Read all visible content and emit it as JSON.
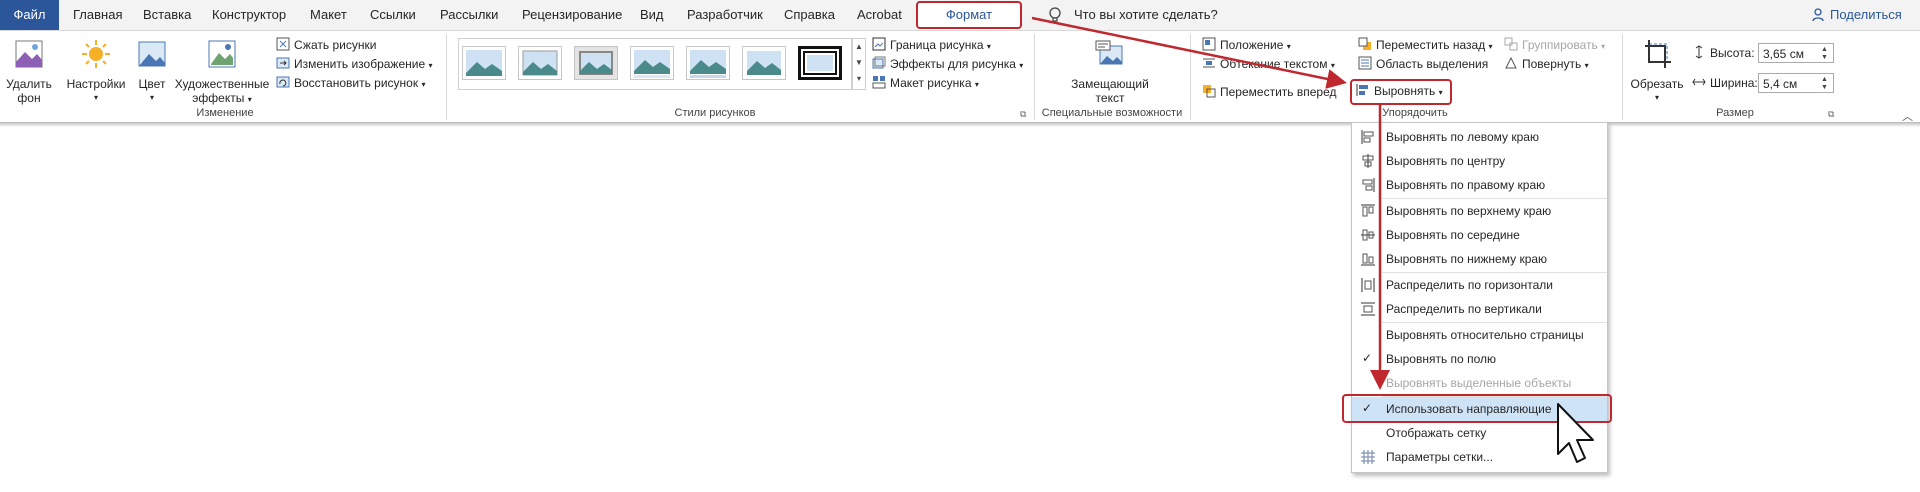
{
  "tabs": {
    "file": "Файл",
    "home": "Главная",
    "insert": "Вставка",
    "design": "Конструктор",
    "layout": "Макет",
    "references": "Ссылки",
    "mailings": "Рассылки",
    "review": "Рецензирование",
    "view": "Вид",
    "developer": "Разработчик",
    "help": "Справка",
    "acrobat": "Acrobat",
    "format": "Формат",
    "tell_me": "Что вы хотите сделать?",
    "share": "Поделиться"
  },
  "groups": {
    "adjust": {
      "label": "Изменение",
      "remove_bg_line1": "Удалить",
      "remove_bg_line2": "фон",
      "corrections": "Настройки",
      "color": "Цвет",
      "artistic_line1": "Художественные",
      "artistic_line2": "эффекты",
      "compress": "Сжать рисунки",
      "change": "Изменить изображение",
      "reset": "Восстановить рисунок"
    },
    "styles": {
      "label": "Стили рисунков",
      "border": "Граница рисунка",
      "effects": "Эффекты для рисунка",
      "layout": "Макет рисунка"
    },
    "accessibility": {
      "label": "Специальные возможности",
      "alt_line1": "Замещающий",
      "alt_line2": "текст"
    },
    "arrange": {
      "label": "Упорядочить",
      "position": "Положение",
      "wrap": "Обтекание текстом",
      "forward": "Переместить вперед",
      "backward": "Переместить назад",
      "selection_pane": "Область выделения",
      "align": "Выровнять",
      "group": "Группировать",
      "rotate": "Повернуть"
    },
    "size": {
      "label": "Размер",
      "crop": "Обрезать",
      "height_label": "Высота:",
      "height_value": "3,65 см",
      "width_label": "Ширина:",
      "width_value": "5,4 см"
    }
  },
  "align_menu": {
    "items": [
      {
        "label": "Выровнять по левому краю",
        "enabled": true
      },
      {
        "label": "Выровнять по центру",
        "enabled": true
      },
      {
        "label": "Выровнять по правому краю",
        "enabled": true
      },
      {
        "label": "Выровнять по верхнему краю",
        "enabled": true
      },
      {
        "label": "Выровнять по середине",
        "enabled": true
      },
      {
        "label": "Выровнять по нижнему краю",
        "enabled": true
      },
      {
        "label": "Распределить по горизонтали",
        "enabled": true
      },
      {
        "label": "Распределить по вертикали",
        "enabled": true
      },
      {
        "label": "Выровнять относительно страницы",
        "enabled": true
      },
      {
        "label": "Выровнять по полю",
        "enabled": true,
        "checked": true
      },
      {
        "label": "Выровнять выделенные объекты",
        "enabled": false
      },
      {
        "label": "Использовать направляющие",
        "enabled": true,
        "checked": true,
        "highlighted": true
      },
      {
        "label": "Отображать сетку",
        "enabled": true
      },
      {
        "label": "Параметры сетки...",
        "enabled": true
      }
    ]
  },
  "colors": {
    "accent": "#2b579a",
    "annotation_red": "#c0282f",
    "highlight": "#cfe3f7"
  }
}
